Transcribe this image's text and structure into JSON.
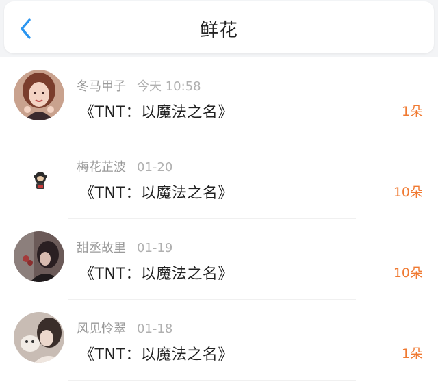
{
  "header": {
    "title": "鲜花",
    "back_icon": "chevron-left-icon",
    "accent_color": "#2a95f0"
  },
  "items": [
    {
      "user": "冬马甲子",
      "time": "今天 10:58",
      "title": "《TNT：以魔法之名》",
      "count": "1朵"
    },
    {
      "user": "梅花芷波",
      "time": "01-20",
      "title": "《TNT：以魔法之名》",
      "count": "10朵"
    },
    {
      "user": "甜丞故里",
      "time": "01-19",
      "title": "《TNT：以魔法之名》",
      "count": "10朵"
    },
    {
      "user": "风见怜翠",
      "time": "01-18",
      "title": "《TNT：以魔法之名》",
      "count": "1朵"
    }
  ],
  "count_color": "#f07a32"
}
